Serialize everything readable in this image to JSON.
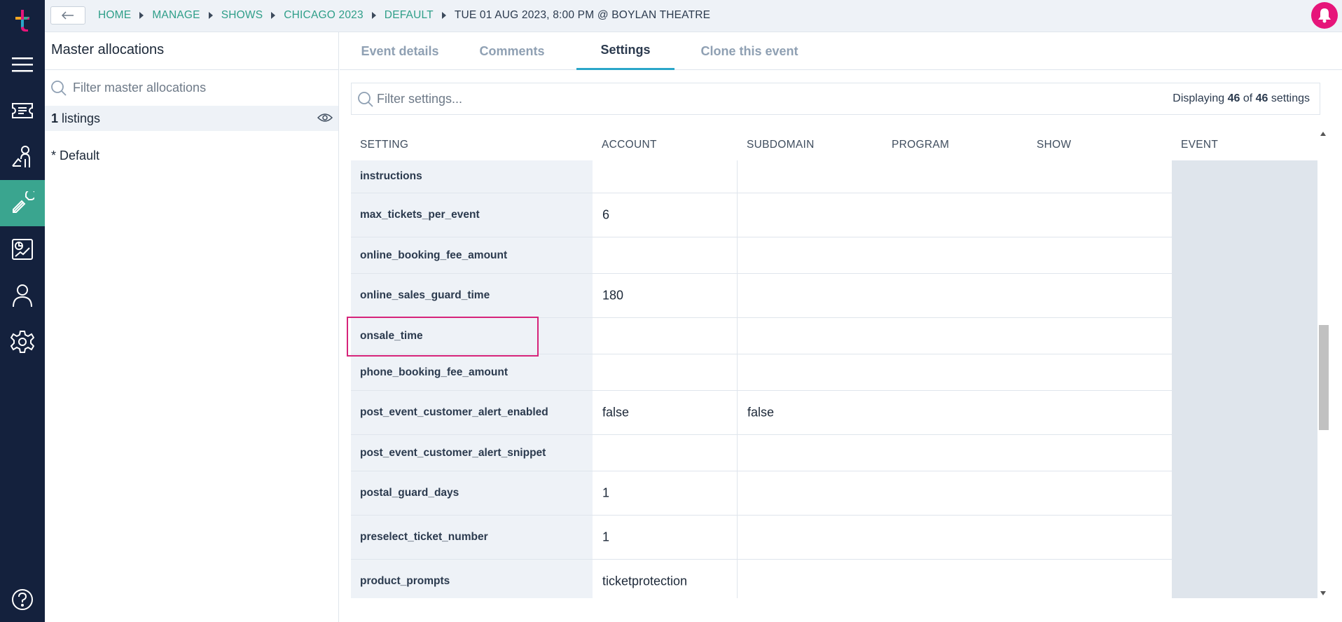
{
  "nav": {
    "items": [
      {
        "name": "menu-icon"
      },
      {
        "name": "ticket-icon"
      },
      {
        "name": "customer-service-icon"
      },
      {
        "name": "wrench-icon",
        "active": true
      },
      {
        "name": "reports-icon"
      },
      {
        "name": "user-icon"
      },
      {
        "name": "gear-icon"
      }
    ],
    "help_icon": "help-icon",
    "active_color": "#3aa58f",
    "rail_color": "#14213d"
  },
  "breadcrumb": {
    "items": [
      "HOME",
      "MANAGE",
      "SHOWS",
      "CHICAGO 2023",
      "DEFAULT"
    ],
    "current": "TUE 01 AUG 2023, 8:00 PM @ BOYLAN THEATRE"
  },
  "left_panel": {
    "title": "Master allocations",
    "search_placeholder": "Filter master allocations",
    "listings_count": "1",
    "listings_label": "listings",
    "default_item": "* Default"
  },
  "tabs": [
    {
      "label": "Event details",
      "active": false
    },
    {
      "label": "Comments",
      "active": false
    },
    {
      "label": "Settings",
      "active": true
    },
    {
      "label": "Clone this event",
      "active": false
    }
  ],
  "settings_filter": {
    "placeholder": "Filter settings...",
    "display_prefix": "Displaying",
    "shown": "46",
    "of": "of",
    "total": "46",
    "suffix": "settings"
  },
  "table": {
    "columns": [
      "SETTING",
      "ACCOUNT",
      "SUBDOMAIN",
      "PROGRAM",
      "SHOW",
      "EVENT"
    ],
    "rows": [
      {
        "setting": "instructions",
        "account": "",
        "subdomain": ""
      },
      {
        "setting": "max_tickets_per_event",
        "account": "6",
        "subdomain": ""
      },
      {
        "setting": "online_booking_fee_amount",
        "account": "",
        "subdomain": ""
      },
      {
        "setting": "online_sales_guard_time",
        "account": "180",
        "subdomain": ""
      },
      {
        "setting": "onsale_time",
        "account": "",
        "subdomain": "",
        "highlighted": true
      },
      {
        "setting": "phone_booking_fee_amount",
        "account": "",
        "subdomain": ""
      },
      {
        "setting": "post_event_customer_alert_enabled",
        "account": "false",
        "subdomain": "false"
      },
      {
        "setting": "post_event_customer_alert_snippet",
        "account": "",
        "subdomain": ""
      },
      {
        "setting": "postal_guard_days",
        "account": "1",
        "subdomain": ""
      },
      {
        "setting": "preselect_ticket_number",
        "account": "1",
        "subdomain": ""
      },
      {
        "setting": "product_prompts",
        "account": "ticketprotection",
        "subdomain": ""
      }
    ]
  },
  "colors": {
    "accent": "#2e9e88",
    "tab_underline": "#2aa6c9",
    "highlight": "#d6247a",
    "bell": "#e6157a"
  }
}
